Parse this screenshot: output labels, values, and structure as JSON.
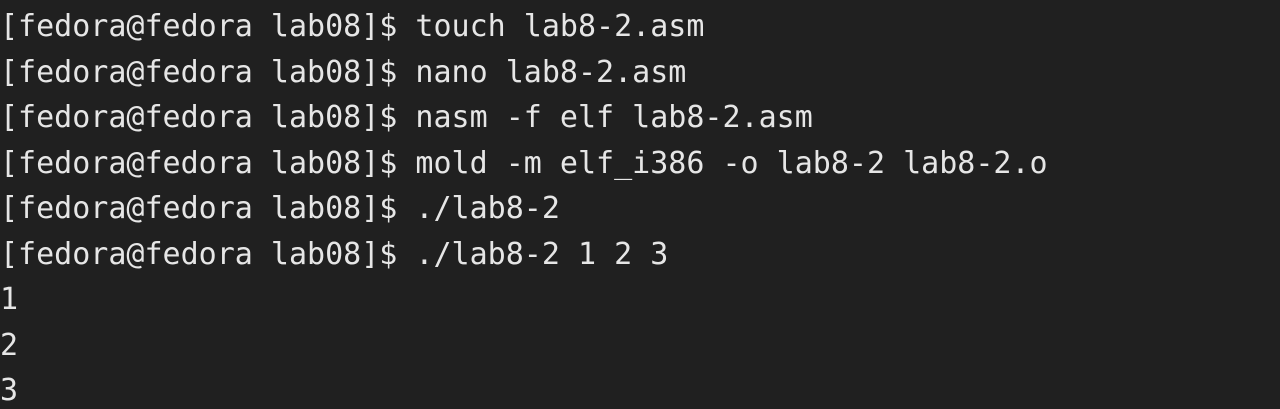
{
  "terminal": {
    "prompt": "[fedora@fedora lab08]$",
    "lines": [
      {
        "type": "command",
        "prompt": "[fedora@fedora lab08]$",
        "command": "touch lab8-2.asm"
      },
      {
        "type": "command",
        "prompt": "[fedora@fedora lab08]$",
        "command": "nano lab8-2.asm"
      },
      {
        "type": "command",
        "prompt": "[fedora@fedora lab08]$",
        "command": "nasm -f elf lab8-2.asm"
      },
      {
        "type": "command",
        "prompt": "[fedora@fedora lab08]$",
        "command": "mold -m elf_i386 -o lab8-2 lab8-2.o"
      },
      {
        "type": "command",
        "prompt": "[fedora@fedora lab08]$",
        "command": "./lab8-2"
      },
      {
        "type": "command",
        "prompt": "[fedora@fedora lab08]$",
        "command": "./lab8-2 1 2 3"
      },
      {
        "type": "output",
        "text": "1"
      },
      {
        "type": "output",
        "text": "2"
      },
      {
        "type": "output",
        "text": "3"
      }
    ],
    "colors": {
      "background": "#202020",
      "foreground": "#e6e6e6"
    }
  }
}
